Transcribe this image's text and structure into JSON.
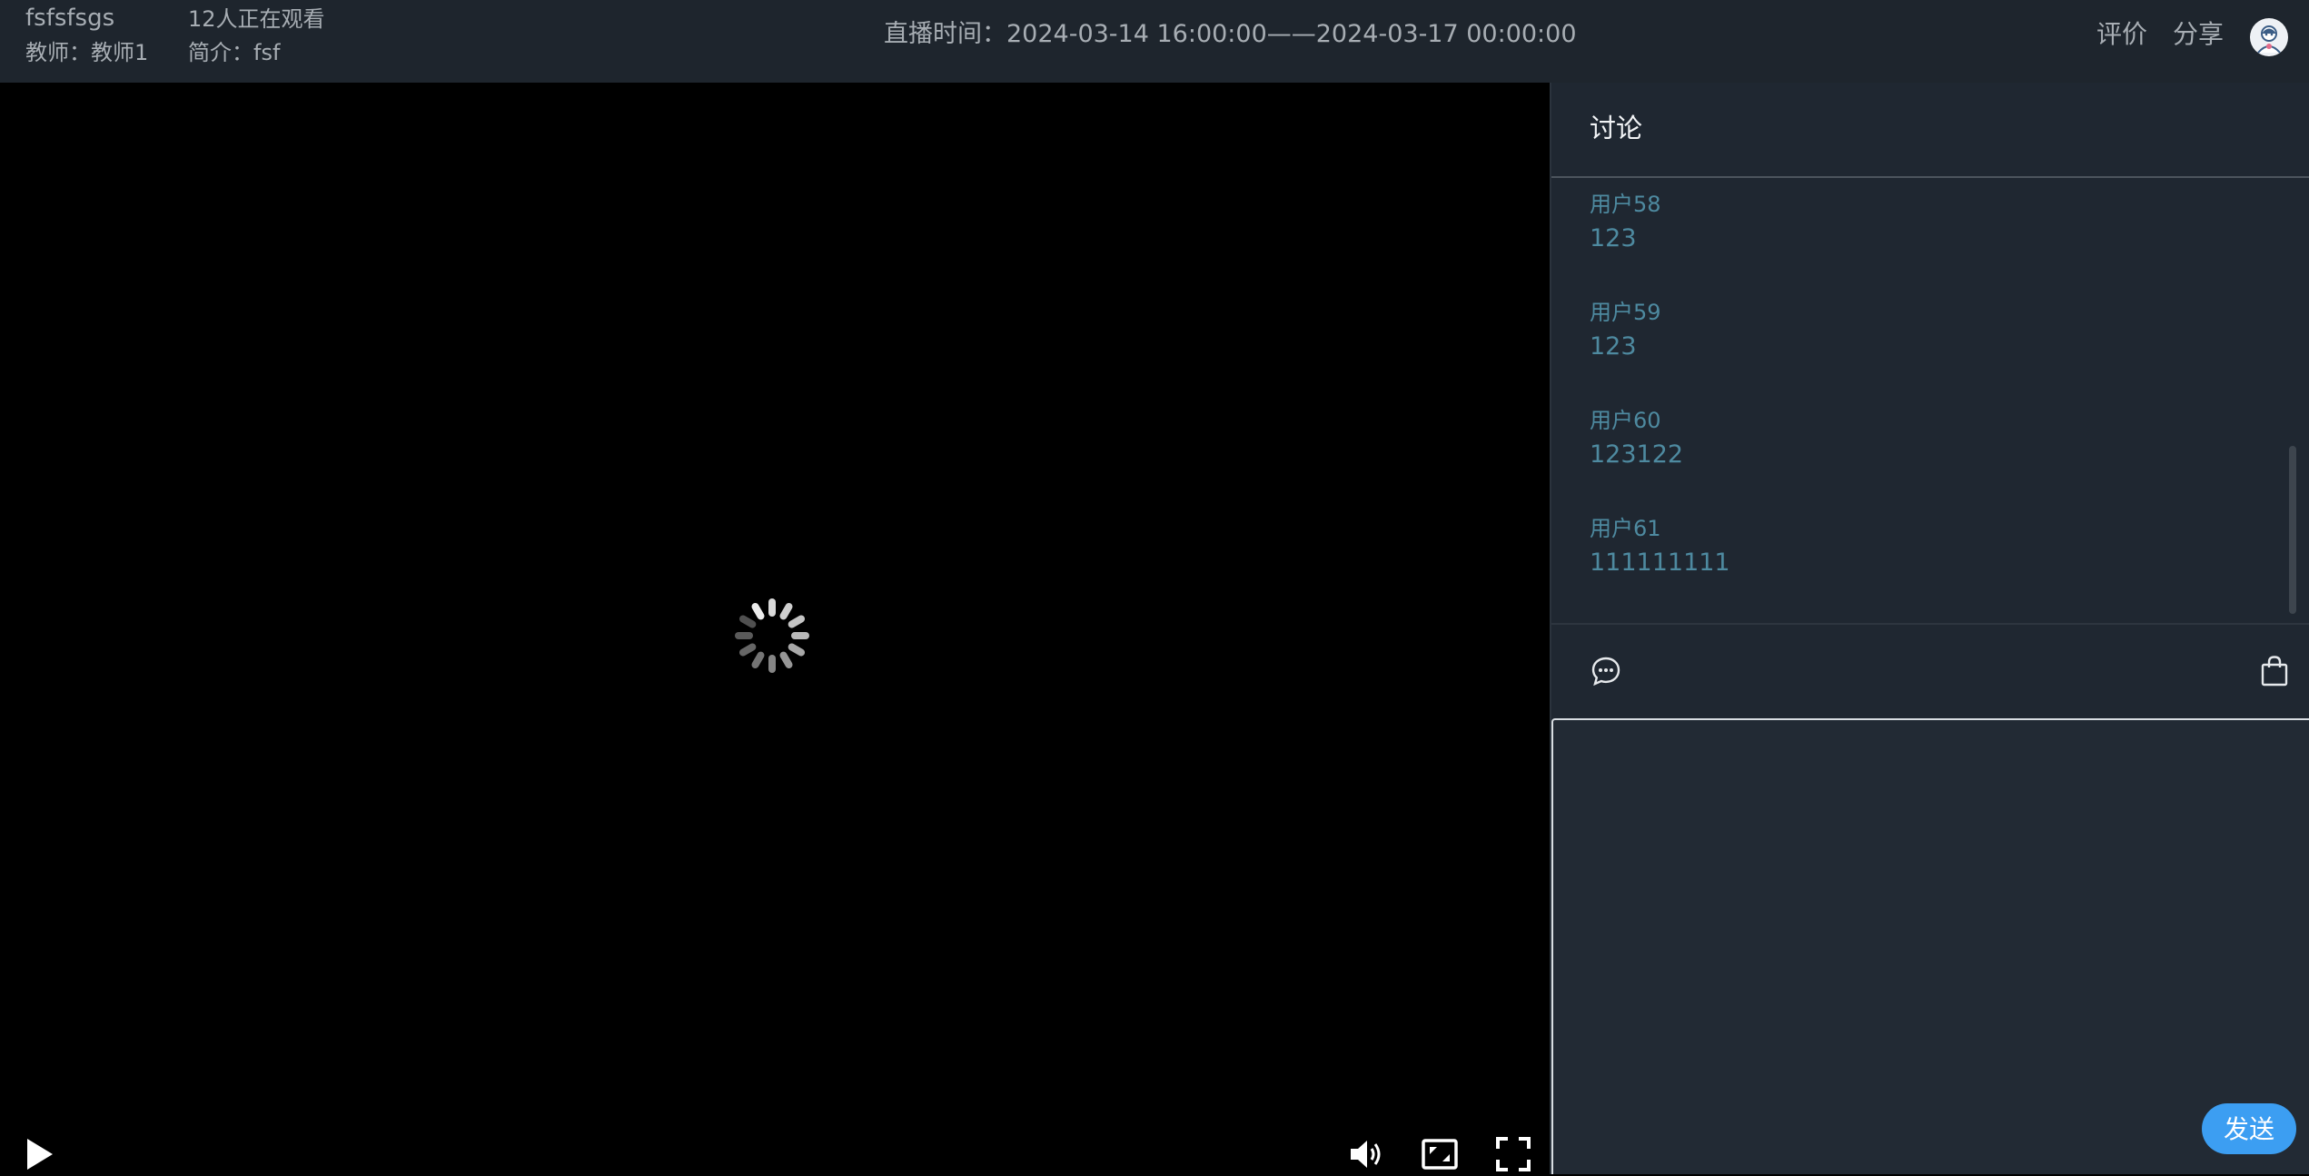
{
  "header": {
    "course_title": "fsfsfsgs",
    "viewers": "12人正在观看",
    "teacher": "教师：教师1",
    "intro": "简介：fsf",
    "live_time": "直播时间：2024-03-14 16:00:00——2024-03-17 00:00:00",
    "rate_label": "评价",
    "share_label": "分享"
  },
  "video": {
    "state": "loading"
  },
  "sidebar": {
    "title": "讨论",
    "messages": [
      {
        "user": "用户58",
        "text": "123"
      },
      {
        "user": "用户59",
        "text": "123"
      },
      {
        "user": "用户60",
        "text": "123122"
      },
      {
        "user": "用户61",
        "text": "111111111"
      }
    ],
    "input_value": "",
    "send_label": "发送"
  },
  "colors": {
    "header_bg": "#1e252d",
    "sidebar_bg": "#1f2731",
    "message_text": "#4e8aa0",
    "send_button": "#3c9ef2"
  }
}
